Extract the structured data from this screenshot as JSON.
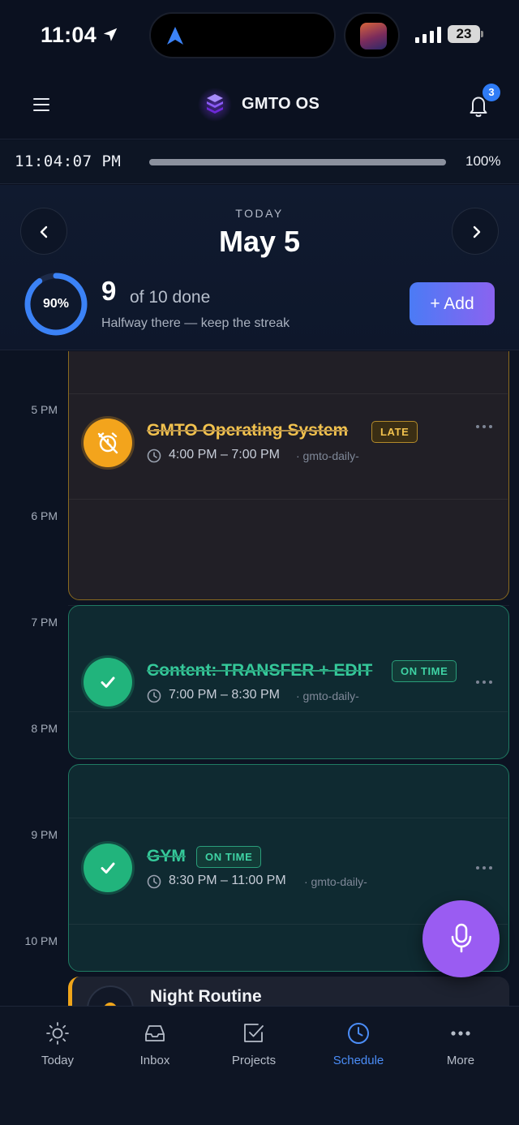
{
  "status_bar": {
    "time": "11:04",
    "battery": "23",
    "icons": [
      "location-arrow-icon",
      "navigation-icon",
      "signal-icon",
      "battery-icon"
    ]
  },
  "header": {
    "app_title": "GMTO OS",
    "notification_count": "3",
    "icons": [
      "menu-icon",
      "logo-icon",
      "bell-icon"
    ]
  },
  "clock": {
    "time": "11:04:07 PM",
    "day_progress": 1.0,
    "percent_label": "100%"
  },
  "date": {
    "kicker": "TODAY",
    "title": "May 5"
  },
  "summary": {
    "ring_label": "90%",
    "ring_value": 0.9,
    "done_count": "9",
    "done_of": "of 10 done",
    "subtitle": "Halfway there — keep the streak",
    "add_label": "+ Add"
  },
  "colors": {
    "late": "#f3a41c",
    "done": "#21b47c",
    "accent": "#4b8df7",
    "fab": "#9a5cf2"
  },
  "hours": [
    "5 PM",
    "6 PM",
    "7 PM",
    "8 PM",
    "9 PM",
    "10 PM"
  ],
  "tasks": [
    {
      "title": "GMTO Operating System",
      "badge": "LATE",
      "time": "4:00 PM – 7:00 PM",
      "source": "· gmto-daily-",
      "status": "late",
      "icon": "alarm-off-icon"
    },
    {
      "title": "Content: TRANSFER + EDIT",
      "badge": "ON TIME",
      "time": "7:00 PM – 8:30 PM",
      "source": "· gmto-daily-",
      "status": "done",
      "icon": "check-icon"
    },
    {
      "title": "GYM",
      "badge": "ON TIME",
      "time": "8:30 PM – 11:00 PM",
      "source": "· gmto-daily-",
      "status": "done",
      "icon": "check-icon"
    },
    {
      "title": "Night Routine",
      "status": "pending"
    }
  ],
  "bottom_nav": [
    {
      "label": "Today",
      "icon": "sun-icon",
      "active": false
    },
    {
      "label": "Inbox",
      "icon": "inbox-icon",
      "active": false
    },
    {
      "label": "Projects",
      "icon": "checkbox-icon",
      "active": false
    },
    {
      "label": "Schedule",
      "icon": "clock-icon",
      "active": true
    },
    {
      "label": "More",
      "icon": "more-dots-icon",
      "active": false
    }
  ]
}
